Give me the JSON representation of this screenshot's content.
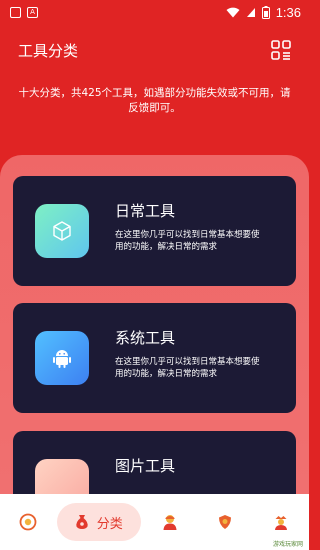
{
  "status_bar": {
    "time": "1:36",
    "notif_a": "A"
  },
  "header": {
    "title": "工具分类"
  },
  "notice": "十大分类，共425个工具，如遇部分功能失效或不可用，请反馈即可。",
  "categories": [
    {
      "title": "日常工具",
      "desc": "在这里你几乎可以找到日常基本想要使用的功能，解决日常的需求",
      "icon": "cube-icon"
    },
    {
      "title": "系统工具",
      "desc": "在这里你几乎可以找到日常基本想要使用的功能，解决日常的需求",
      "icon": "android-icon"
    },
    {
      "title": "图片工具",
      "desc": "",
      "icon": "image-icon"
    }
  ],
  "bottom_nav": {
    "active_label": "分类",
    "items": [
      "home-icon",
      "category-icon",
      "person-icon",
      "shield-icon",
      "profile-icon"
    ]
  },
  "watermark": "游戏玩家网",
  "colors": {
    "primary": "#e02424",
    "card": "#1c1a35",
    "panel": "#f07070",
    "accent_text": "#e23a2e"
  }
}
